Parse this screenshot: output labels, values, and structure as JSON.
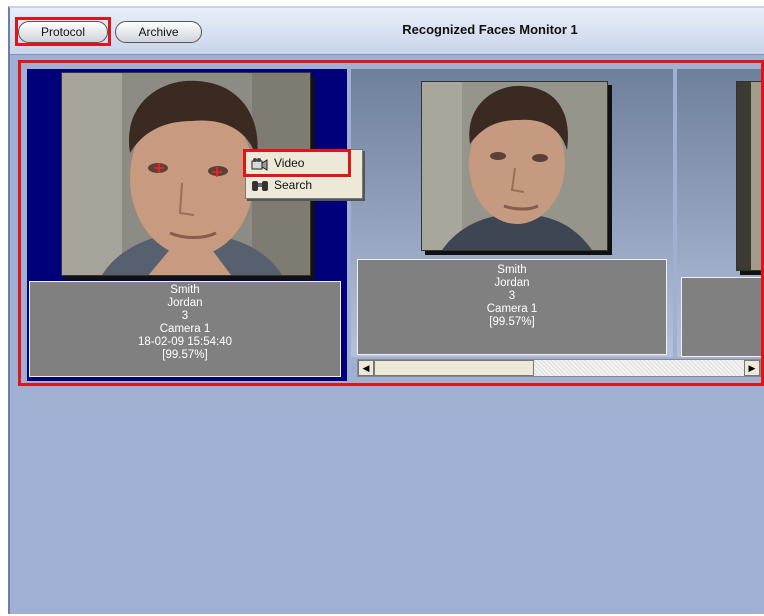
{
  "toolbar": {
    "protocol_label": "Protocol",
    "archive_label": "Archive",
    "title": "Recognized Faces Monitor 1"
  },
  "cards": [
    {
      "last_name": "Smith",
      "first_name": "Jordan",
      "id": "3",
      "camera": "Camera 1",
      "timestamp": "18-02-09 15:54:40",
      "confidence": "[99.57%]",
      "selected": true
    },
    {
      "last_name": "Smith",
      "first_name": "Jordan",
      "id": "3",
      "camera": "Camera 1",
      "confidence": "[99.57%]",
      "selected": false
    }
  ],
  "context_menu": {
    "items": [
      {
        "label": "Video",
        "icon": "camcorder-icon"
      },
      {
        "label": "Search",
        "icon": "binoculars-icon"
      }
    ]
  },
  "colors": {
    "highlight": "#e0141b",
    "selected_card": "#00007a",
    "panel_background": "#9fb0d2",
    "info_background": "#808080"
  }
}
